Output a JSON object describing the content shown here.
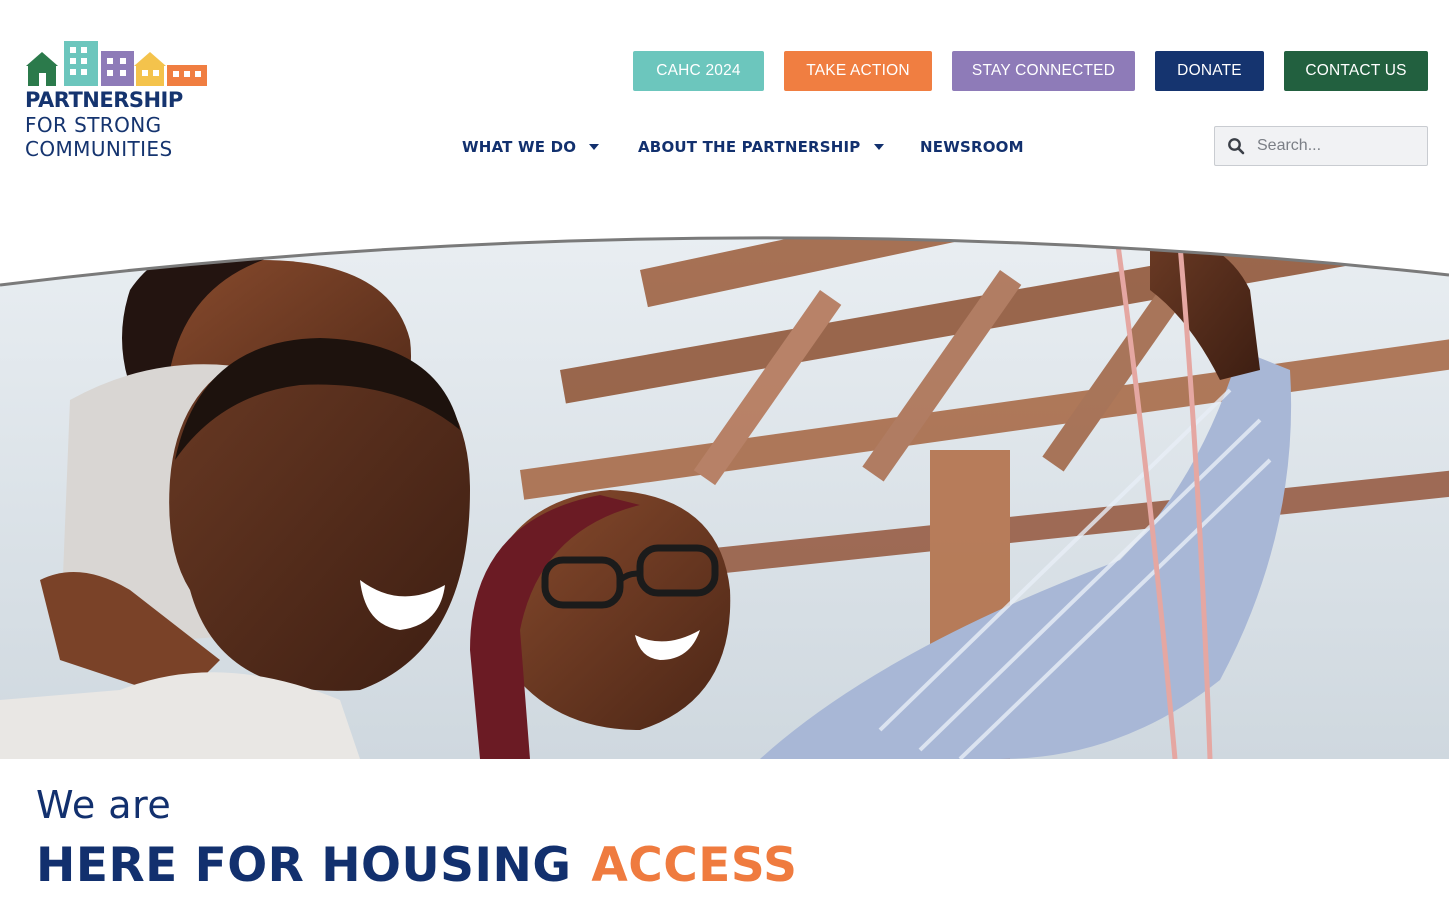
{
  "logo": {
    "line1": "PARTNERSHIP",
    "line2": "FOR STRONG",
    "line3": "COMMUNITIES",
    "colors": [
      "#2b7a4b",
      "#6cc6bd",
      "#8e7bb8",
      "#f4c34c",
      "#f07e41",
      "#15346f"
    ]
  },
  "top_buttons": [
    {
      "label": "CAHC 2024",
      "color": "#6cc6bd"
    },
    {
      "label": "TAKE ACTION",
      "color": "#f07e41"
    },
    {
      "label": "STAY CONNECTED",
      "color": "#8e7bb8"
    },
    {
      "label": "DONATE",
      "color": "#15346f"
    },
    {
      "label": "CONTACT US",
      "color": "#22603f"
    }
  ],
  "nav": [
    {
      "label": "WHAT WE DO",
      "has_dropdown": true
    },
    {
      "label": "ABOUT THE PARTNERSHIP",
      "has_dropdown": true
    },
    {
      "label": "NEWSROOM",
      "has_dropdown": false
    }
  ],
  "search": {
    "placeholder": "Search...",
    "value": "",
    "icon": "search-icon"
  },
  "hero": {
    "image_subject": "family-photo",
    "icons": [
      "curved-top-edge"
    ]
  },
  "headline": {
    "intro": "We are",
    "main": "HERE FOR HOUSING",
    "accent": "ACCESS",
    "main_color": "#12306e",
    "accent_color": "#ef7b3f"
  }
}
